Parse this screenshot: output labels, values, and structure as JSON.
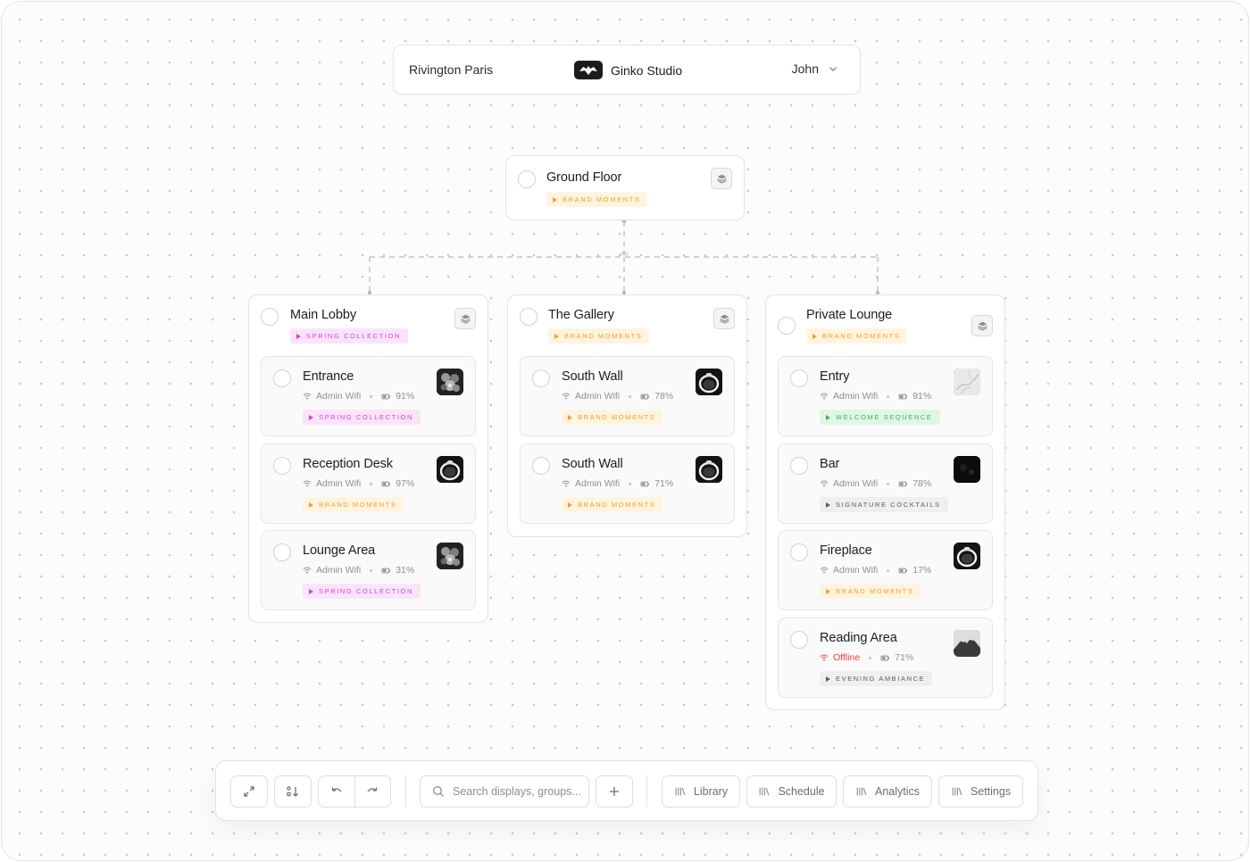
{
  "topbar": {
    "location": "Rivington Paris",
    "brand": "Ginko Studio",
    "user": "John"
  },
  "ground_floor": {
    "title": "Ground Floor",
    "tag": "Brand Moments"
  },
  "groups": [
    {
      "title": "Main Lobby",
      "tag": "Spring Collection",
      "items": [
        {
          "title": "Entrance",
          "network": "Admin Wifi",
          "battery": "91%",
          "tag": "Spring Collection"
        },
        {
          "title": "Reception Desk",
          "network": "Admin Wifi",
          "battery": "97%",
          "tag": "Brand Moments"
        },
        {
          "title": "Lounge Area",
          "network": "Admin Wifi",
          "battery": "31%",
          "tag": "Spring Collection"
        }
      ]
    },
    {
      "title": "The Gallery",
      "tag": "Brand Moments",
      "items": [
        {
          "title": "South Wall",
          "network": "Admin Wifi",
          "battery": "78%",
          "tag": "Brand Moments"
        },
        {
          "title": "South Wall",
          "network": "Admin Wifi",
          "battery": "71%",
          "tag": "Brand Moments"
        }
      ]
    },
    {
      "title": "Private Lounge",
      "tag": "Brand Moments",
      "items": [
        {
          "title": "Entry",
          "network": "Admin Wifi",
          "battery": "91%",
          "tag": "Welcome Sequence"
        },
        {
          "title": "Bar",
          "network": "Admin Wifi",
          "battery": "78%",
          "tag": "Signature Cocktails"
        },
        {
          "title": "Fireplace",
          "network": "Admin Wifi",
          "battery": "17%",
          "tag": "Brand Moments"
        },
        {
          "title": "Reading Area",
          "network": "Offline",
          "battery": "71%",
          "tag": "Evening Ambiance"
        }
      ]
    }
  ],
  "toolbar": {
    "search_placeholder": "Search displays, groups...",
    "library": "Library",
    "schedule": "Schedule",
    "analytics": "Analytics",
    "settings": "Settings"
  },
  "colors": {
    "tag_orange": "#f2a01f",
    "tag_pink": "#d441d4",
    "tag_green": "#3fb25a",
    "tag_gray": "#5c5c63",
    "offline": "#ff3b30"
  }
}
